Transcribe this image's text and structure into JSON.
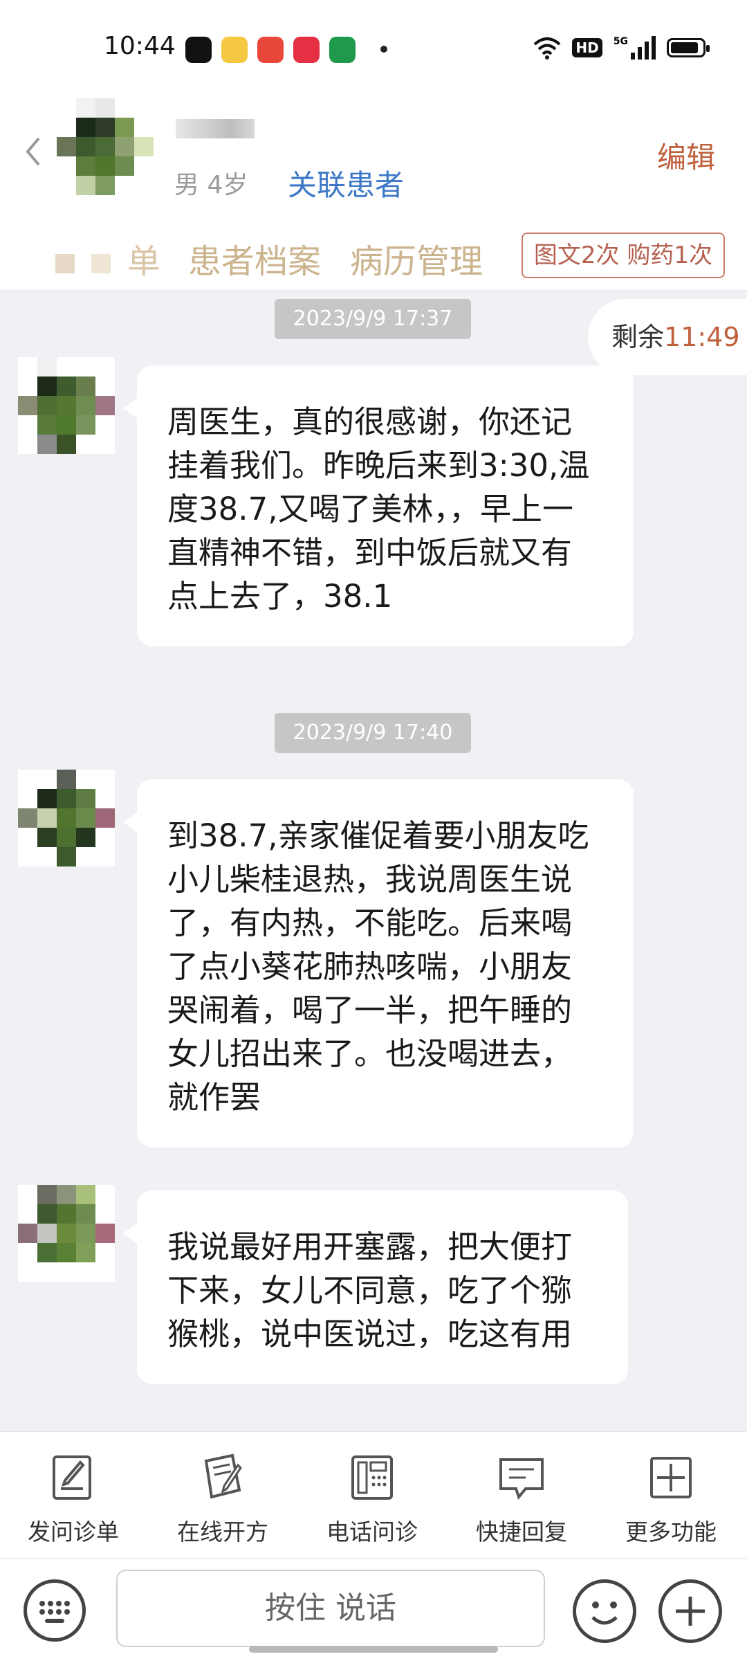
{
  "status_bar": {
    "time": "10:44",
    "apps": [
      "douyin-icon",
      "weibo-icon",
      "meituan-icon",
      "xiaohongshu-icon",
      "oppo-icon"
    ],
    "network": "5G",
    "hd": "HD"
  },
  "header": {
    "gender_age": "男 4岁",
    "link_patient": "关联患者",
    "edit": "编辑",
    "tabs": [
      "单",
      "患者档案",
      "病历管理"
    ],
    "badge": "图文2次 购药1次"
  },
  "chat": {
    "remaining_label": "剩余",
    "remaining_time": "11:49",
    "messages": [
      {
        "time": "2023/9/9 17:37",
        "text": "周医生，真的很感谢，你还记\n挂着我们。昨晚后来到3:30,温\n度38.7,又喝了美林，，早上一\n直精神不错，到中饭后就又有\n点上去了，38.1"
      },
      {
        "time": "2023/9/9 17:40",
        "text": "到38.7,亲家催促着要小朋友吃\n小儿柴桂退热，我说周医生说\n了，有内热，不能吃。后来喝\n了点小葵花肺热咳喘，小朋友\n哭闹着，喝了一半，把午睡的\n女儿招出来了。也没喝进去，\n就作罢"
      },
      {
        "time": "",
        "text": "我说最好用开塞露，把大便打\n下来，女儿不同意，吃了个猕\n猴桃，说中医说过，吃这有用"
      }
    ]
  },
  "toolbar": {
    "items": [
      {
        "label": "发问诊单",
        "icon": "form-icon"
      },
      {
        "label": "在线开方",
        "icon": "prescription-icon"
      },
      {
        "label": "电话问诊",
        "icon": "phone-icon"
      },
      {
        "label": "快捷回复",
        "icon": "quick-reply-icon"
      },
      {
        "label": "更多功能",
        "icon": "more-icon"
      }
    ]
  },
  "input": {
    "hold_to_talk": "按住 说话"
  },
  "colors": {
    "accent": "#c05f3c",
    "link": "#3d79c7",
    "tab_text": "#cbb48e",
    "chat_bg": "#f1f1f5"
  }
}
